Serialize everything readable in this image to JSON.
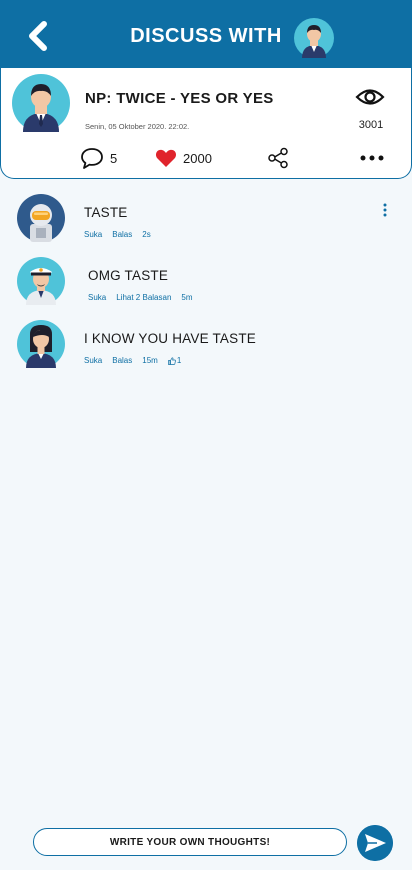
{
  "header": {
    "title": "DISCUSS WITH",
    "back_icon": "chevron-left-icon"
  },
  "post": {
    "title": "NP: TWICE - YES OR YES",
    "date": "Senin, 05 Oktober 2020. 22:02.",
    "views": "3001",
    "comments": "5",
    "likes": "2000"
  },
  "comments": [
    {
      "text": "TASTE",
      "like": "Suka",
      "reply": "Balas",
      "time": "2s",
      "avatar": "astronaut-avatar"
    },
    {
      "text": "OMG TASTE",
      "like": "Suka",
      "reply": "Lihat 2 Balasan",
      "time": "5m",
      "avatar": "captain-avatar"
    },
    {
      "text": "I KNOW YOU HAVE TASTE",
      "like": "Suka",
      "reply": "Balas",
      "time": "15m",
      "reaction": "1",
      "avatar": "woman-avatar"
    }
  ],
  "composer": {
    "placeholder": "WRITE YOUR OWN THOUGHTS!"
  },
  "colors": {
    "primary": "#0e6fa4",
    "heart": "#e0242c",
    "avatar_bg": "#4fc3d9"
  }
}
